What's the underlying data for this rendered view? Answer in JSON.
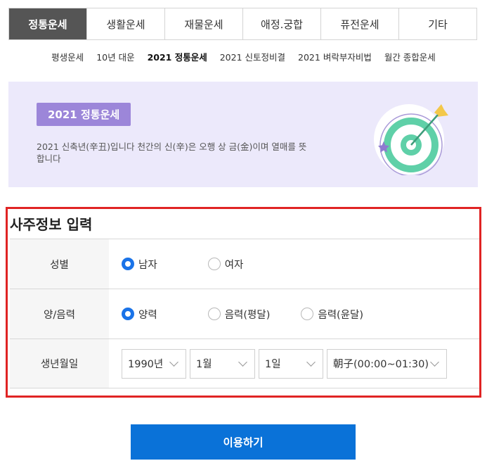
{
  "tabs": [
    {
      "label": "정통운세",
      "active": true
    },
    {
      "label": "생활운세",
      "active": false
    },
    {
      "label": "재물운세",
      "active": false
    },
    {
      "label": "애정.궁합",
      "active": false
    },
    {
      "label": "퓨전운세",
      "active": false
    },
    {
      "label": "기타",
      "active": false
    }
  ],
  "subnav": [
    {
      "label": "평생운세",
      "active": false
    },
    {
      "label": "10년 대운",
      "active": false
    },
    {
      "label": "2021 정통운세",
      "active": true
    },
    {
      "label": "2021 신토정비결",
      "active": false
    },
    {
      "label": "2021 벼락부자비법",
      "active": false
    },
    {
      "label": "월간 종합운세",
      "active": false
    }
  ],
  "banner": {
    "badge": "2021 정통운세",
    "description": "2021 신축년(辛丑)입니다 천간의 신(辛)은 오행 상 금(金)이며 열매를 뜻합니다",
    "icon": "target-with-arrow-icon",
    "colors": {
      "background": "#ece9fb",
      "badge": "#9c86d9",
      "target": "#5fd0a8"
    }
  },
  "form": {
    "title": "사주정보 입력",
    "gender": {
      "label": "성별",
      "options": [
        {
          "label": "남자",
          "checked": true
        },
        {
          "label": "여자",
          "checked": false
        }
      ]
    },
    "calendar": {
      "label": "양/음력",
      "options": [
        {
          "label": "양력",
          "checked": true
        },
        {
          "label": "음력(평달)",
          "checked": false
        },
        {
          "label": "음력(윤달)",
          "checked": false
        }
      ]
    },
    "birth": {
      "label": "생년월일",
      "year": "1990년",
      "month": "1월",
      "day": "1일",
      "time": "朝子(00:00~01:30)"
    }
  },
  "submit_label": "이용하기",
  "colors": {
    "accent": "#1a73e8",
    "button": "#0a72d8",
    "highlight_border": "#e02424",
    "active_tab": "#555555"
  }
}
